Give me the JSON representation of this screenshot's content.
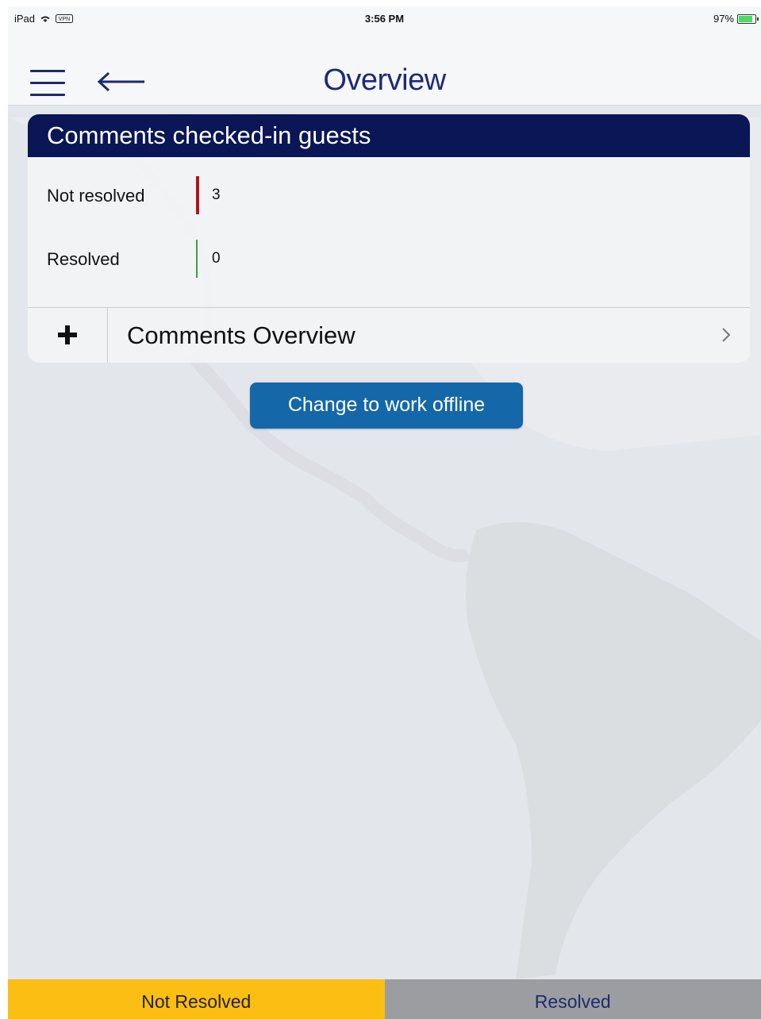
{
  "status_bar": {
    "device": "iPad",
    "time": "3:56 PM",
    "battery": "97%"
  },
  "nav": {
    "title": "Overview"
  },
  "card": {
    "title": "Comments checked-in guests",
    "stats": [
      {
        "label": "Not resolved",
        "value": "3",
        "color": "#b0121b"
      },
      {
        "label": "Resolved",
        "value": "0",
        "color": "#3aa043"
      }
    ],
    "footer_label": "Comments Overview"
  },
  "offline_button": {
    "label": "Change to work offline"
  },
  "tabs": [
    {
      "label": "Not Resolved",
      "color": "#fcbe12"
    },
    {
      "label": "Resolved",
      "color": "#9b9da1"
    }
  ],
  "icons": {
    "menu": "hamburger-menu-icon",
    "back": "back-arrow-icon",
    "add": "plus-icon",
    "disclosure": "chevron-right-icon",
    "wifi": "wifi-icon",
    "vpn": "vpn-icon",
    "battery": "battery-icon"
  }
}
